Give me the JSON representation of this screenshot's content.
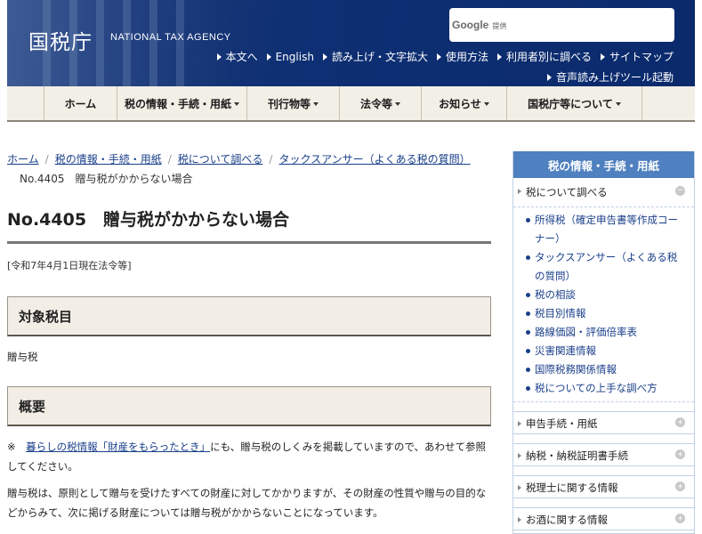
{
  "header": {
    "logo": "国税庁",
    "logo_en": "NATIONAL TAX AGENCY",
    "search_brand": "Google",
    "search_provided": "提供",
    "util_links": [
      "本文へ",
      "English",
      "読み上げ・文字拡大",
      "使用方法",
      "利用者別に調べる",
      "サイトマップ"
    ],
    "voice_tool": "音声読み上げツール起動"
  },
  "gnav": [
    "ホーム",
    "税の情報・手続・用紙",
    "刊行物等",
    "法令等",
    "お知らせ",
    "国税庁等について"
  ],
  "breadcrumb": {
    "links": [
      "ホーム",
      "税の情報・手続・用紙",
      "税について調べる",
      "タックスアンサー（よくある税の質問）"
    ],
    "current": "No.4405　贈与税がかからない場合"
  },
  "main": {
    "title": "No.4405　贈与税がかからない場合",
    "date": "[令和7年4月1日現在法令等]",
    "h_subject": "対象税目",
    "subject_value": "贈与税",
    "h_overview": "概要",
    "note_prefix": "※　",
    "note_link": "暮らしの税情報「財産をもらったとき」",
    "note_rest": "にも、贈与税のしくみを掲載していますので、あわせて参照してください。",
    "body": "贈与税は、原則として贈与を受けたすべての財産に対してかかりますが、その財産の性質や贈与の目的などからみて、次に掲げる財産については贈与税がかからないことになっています。"
  },
  "sidebar": {
    "heading": "税の情報・手続・用紙",
    "section": "税について調べる",
    "items": [
      "所得税（確定申告書等作成コーナー）",
      "タックスアンサー（よくある税の質問）",
      "税の相談",
      "税目別情報",
      "路線価図・評価倍率表",
      "災害関連情報",
      "国際税務関係情報",
      "税についての上手な調べ方"
    ],
    "boxes": [
      "申告手続・用紙",
      "納税・納税証明書手続",
      "税理士に関する情報",
      "お酒に関する情報"
    ]
  },
  "colors": {
    "header_bg": "#0e2f73",
    "nav_bg": "#f2efe6",
    "side_head": "#4f80bf",
    "link": "#1a3f8a"
  }
}
